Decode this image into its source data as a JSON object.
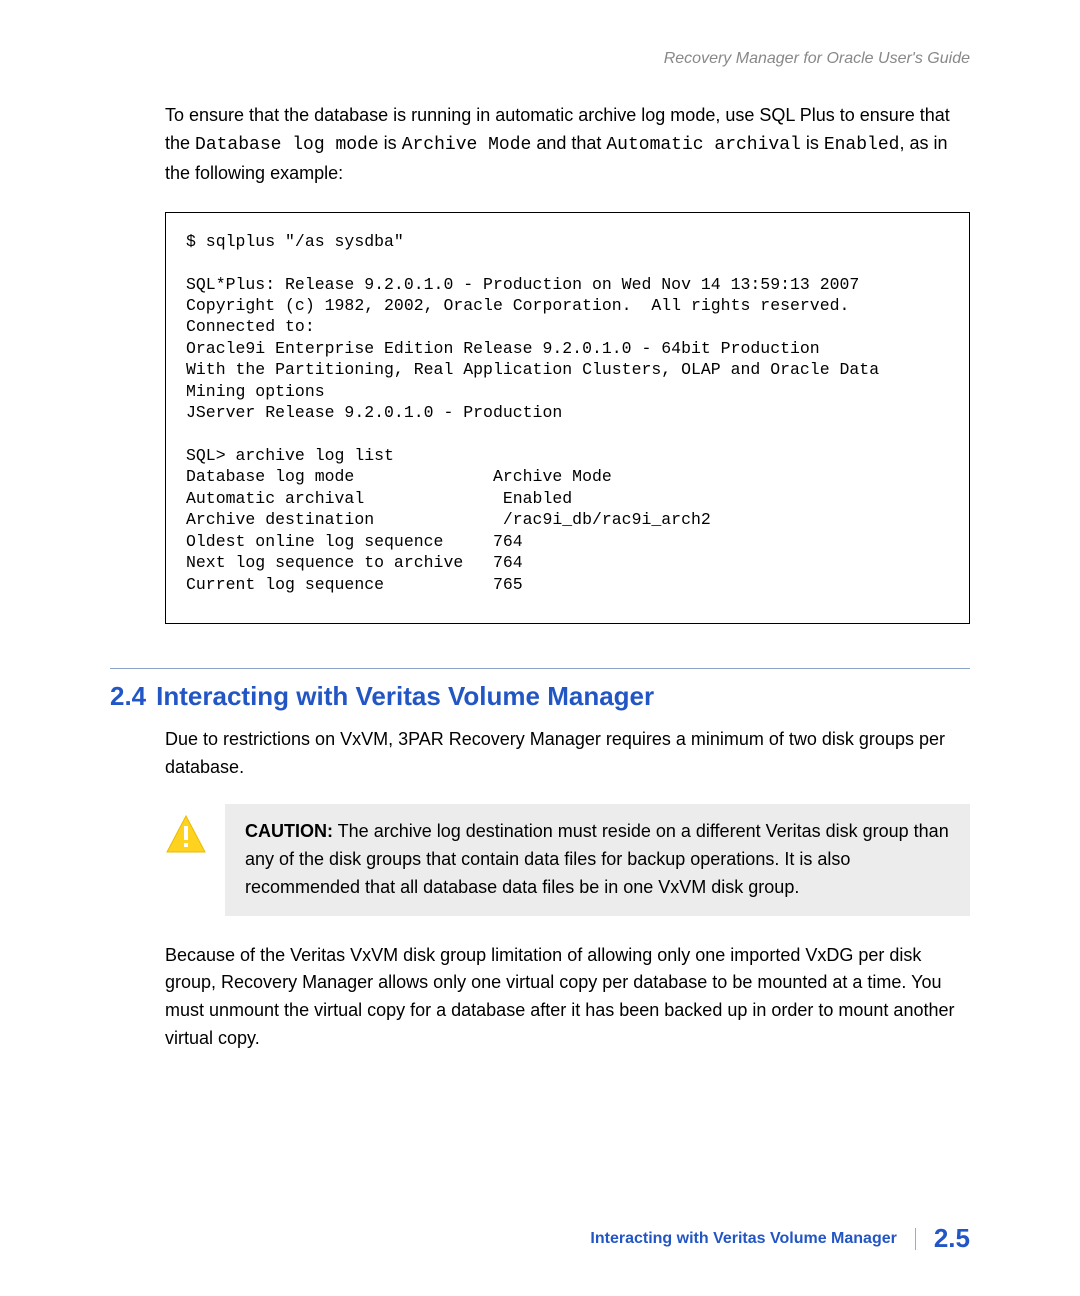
{
  "header": {
    "title": "Recovery Manager for Oracle User's Guide"
  },
  "intro": {
    "lead": "To ensure that the database is running in automatic archive log mode, use SQL Plus to ensure that the ",
    "code1": "Database log mode",
    "mid1": " is ",
    "code2": "Archive Mode",
    "mid2": " and that ",
    "code3": "Automatic archival",
    "mid3": " is ",
    "code4": "Enabled",
    "tail": ", as in the following example:"
  },
  "codeblock": "$ sqlplus \"/as sysdba\"\n\nSQL*Plus: Release 9.2.0.1.0 - Production on Wed Nov 14 13:59:13 2007\nCopyright (c) 1982, 2002, Oracle Corporation.  All rights reserved.\nConnected to:\nOracle9i Enterprise Edition Release 9.2.0.1.0 - 64bit Production\nWith the Partitioning, Real Application Clusters, OLAP and Oracle Data\nMining options\nJServer Release 9.2.0.1.0 - Production\n\nSQL> archive log list\nDatabase log mode              Archive Mode\nAutomatic archival              Enabled\nArchive destination             /rac9i_db/rac9i_arch2\nOldest online log sequence     764\nNext log sequence to archive   764\nCurrent log sequence           765",
  "section": {
    "number": "2.4",
    "title": "Interacting with Veritas Volume Manager",
    "para1": "Due to restrictions on VxVM, 3PAR Recovery Manager requires a minimum of two disk groups per database.",
    "caution_label": "CAUTION:",
    "caution_text": " The archive log destination must reside on a different Veritas disk group than any of the disk groups that contain data files for backup operations. It is also recommended that all database data files be in one VxVM disk group.",
    "para2": "Because of the Veritas VxVM disk group limitation of allowing only one imported VxDG per disk group, Recovery Manager allows only one virtual copy per database to be mounted at a time. You must unmount the virtual copy for a database after it has been backed up in order to mount another virtual copy."
  },
  "footer": {
    "title": "Interacting with Veritas Volume Manager",
    "page": "2.5"
  }
}
